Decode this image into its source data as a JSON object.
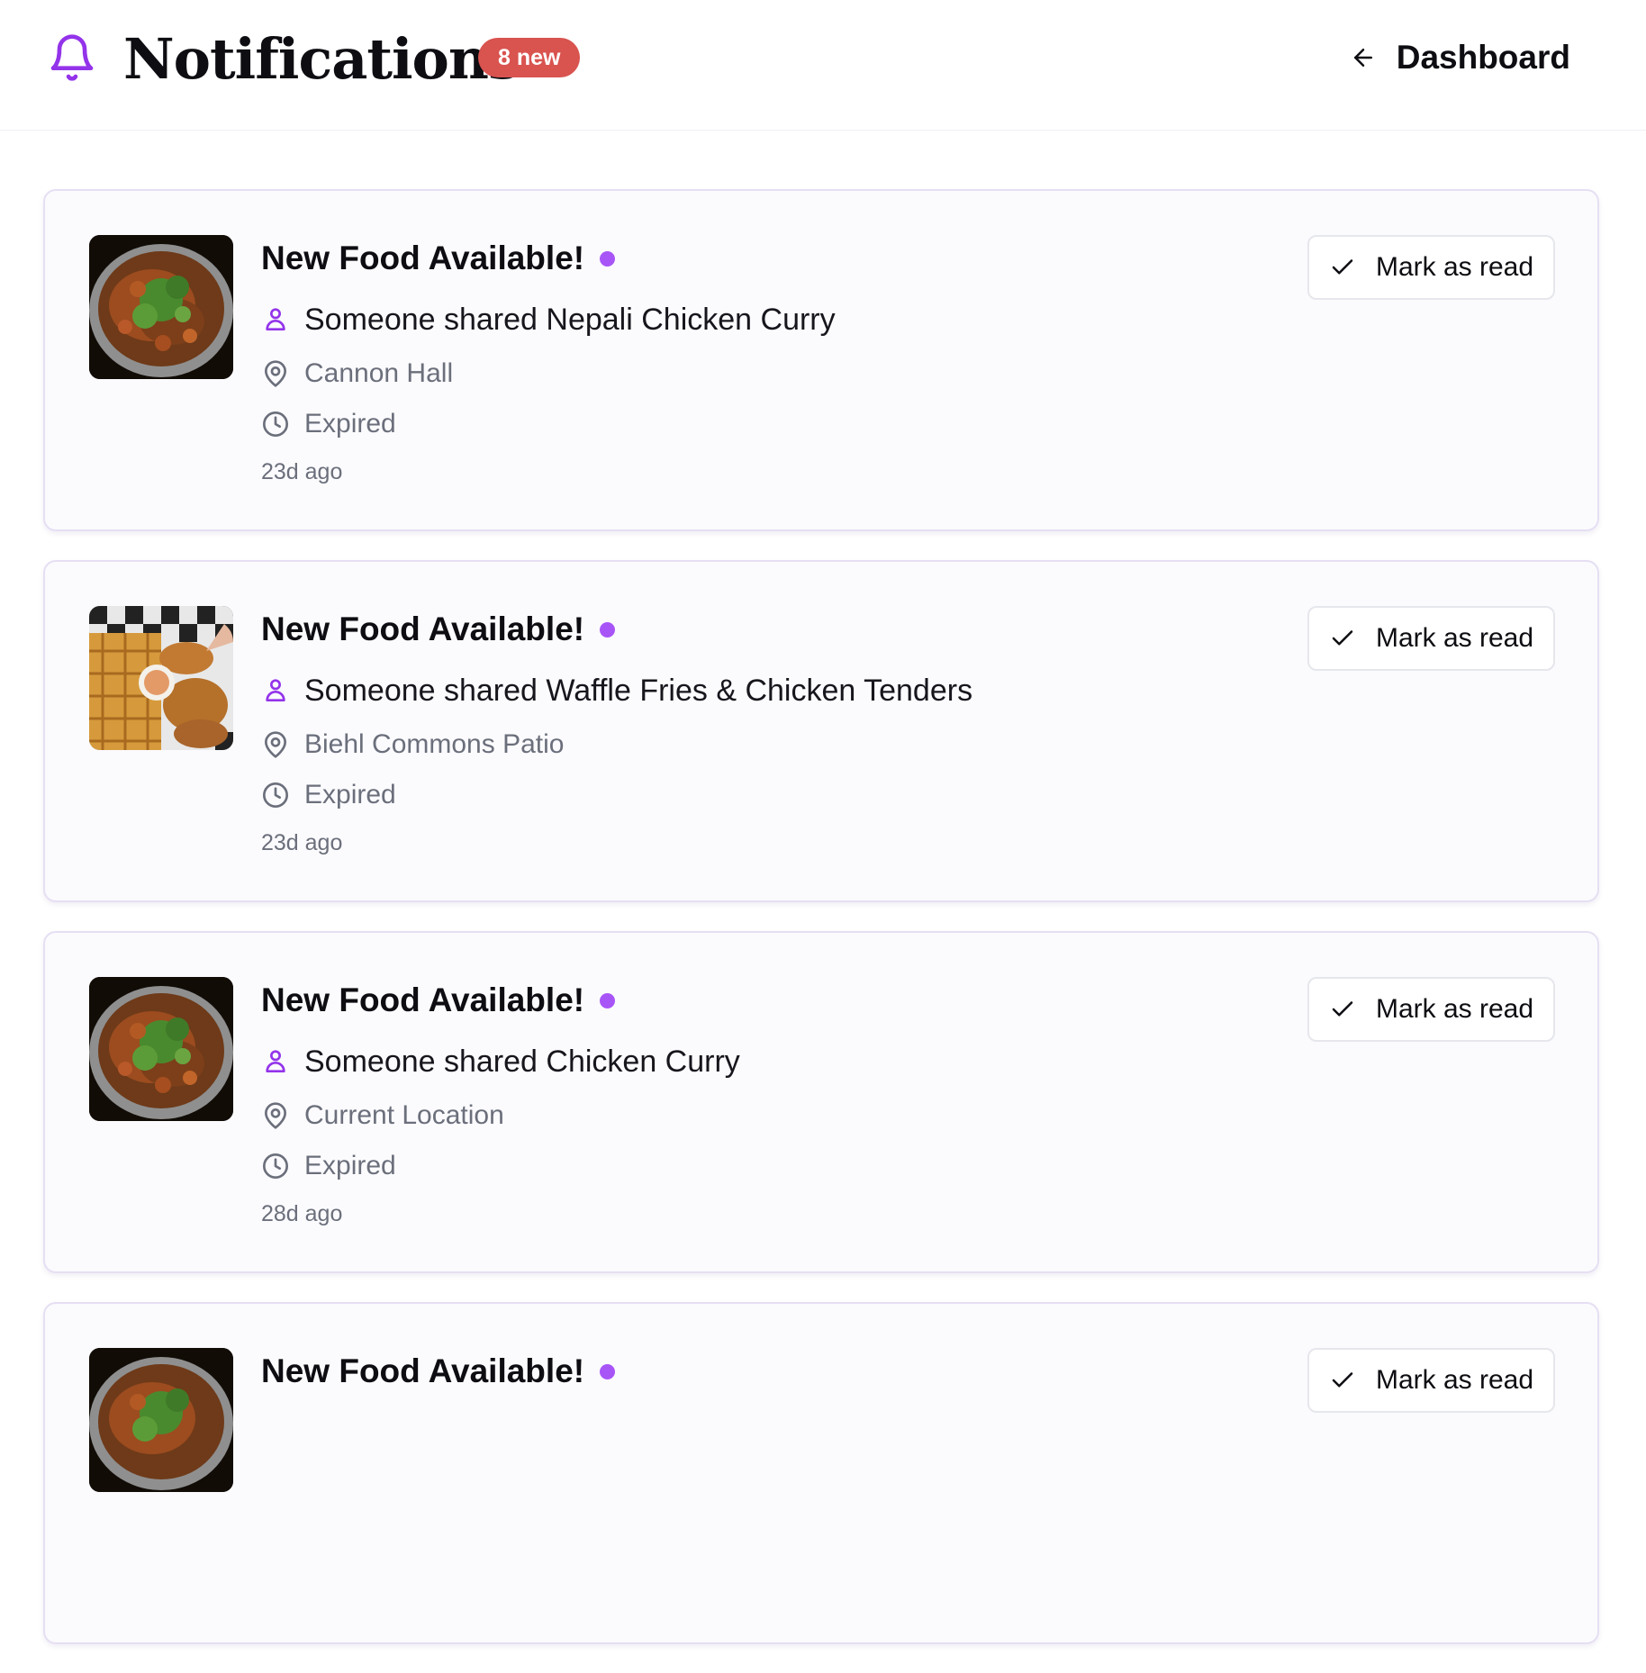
{
  "header": {
    "title": "Notifications",
    "title_icon": "bell-icon",
    "new_badge": "8 new",
    "nav_link": {
      "label": "Dashboard",
      "icon": "arrow-left-icon"
    }
  },
  "colors": {
    "accent": "#a855f7",
    "badge": "#d9534f"
  },
  "notifications": [
    {
      "title": "New Food Available!",
      "unread": true,
      "sharer": "Someone shared Nepali Chicken Curry",
      "location": "Cannon Hall",
      "status": "Expired",
      "time_ago": "23d ago",
      "image": "curry-photo",
      "action_label": "Mark as read"
    },
    {
      "title": "New Food Available!",
      "unread": true,
      "sharer": "Someone shared Waffle Fries & Chicken Tenders",
      "location": "Biehl Commons Patio",
      "status": "Expired",
      "time_ago": "23d ago",
      "image": "fries-tenders-photo",
      "action_label": "Mark as read"
    },
    {
      "title": "New Food Available!",
      "unread": true,
      "sharer": "Someone shared Chicken Curry",
      "location": "Current Location",
      "status": "Expired",
      "time_ago": "28d ago",
      "image": "curry-photo",
      "action_label": "Mark as read"
    },
    {
      "title": "New Food Available!",
      "unread": true,
      "image": "curry-photo",
      "action_label": "Mark as read"
    }
  ]
}
